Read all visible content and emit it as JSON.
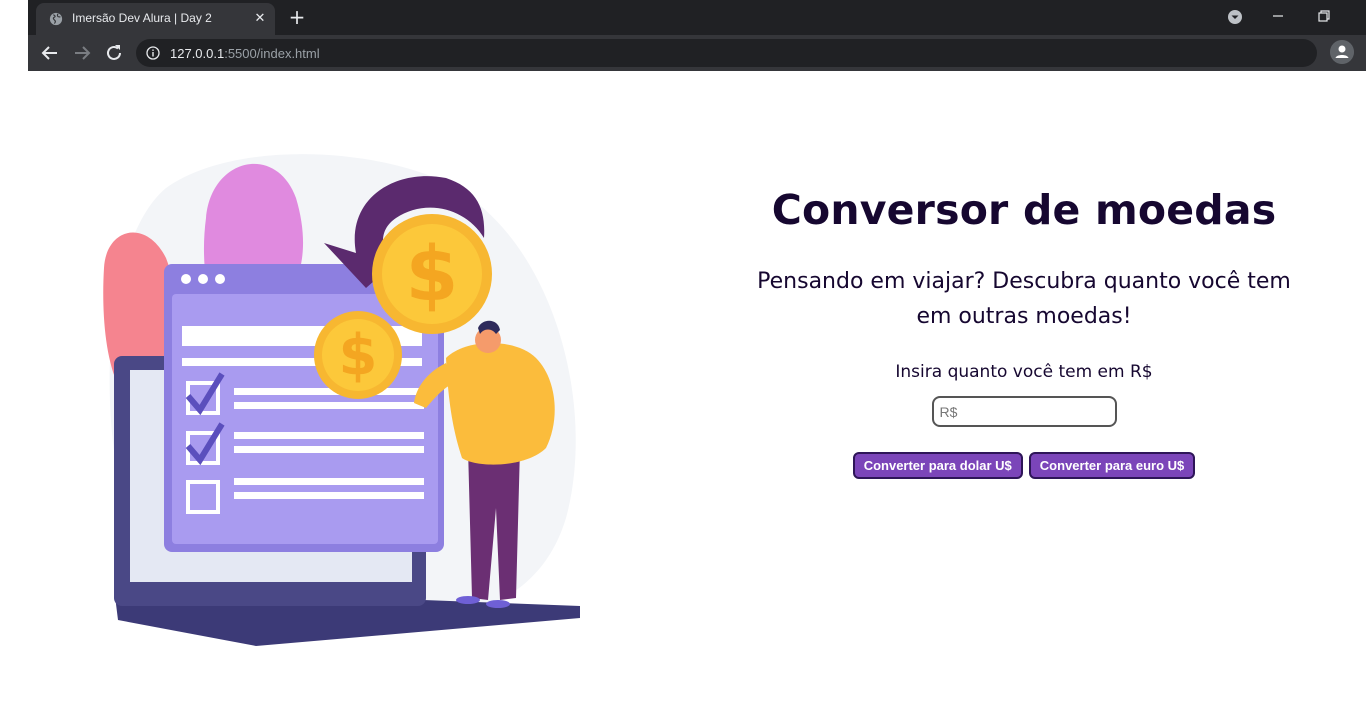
{
  "browser": {
    "tab_title": "Imersão Dev Alura | Day 2",
    "url_host": "127.0.0.1",
    "url_rest": ":5500/index.html"
  },
  "page": {
    "title": "Conversor de moedas",
    "subtitle": "Pensando em viajar? Descubra quanto você tem em outras moedas!",
    "input_label": "Insira quanto você tem em R$",
    "input_placeholder": "R$",
    "input_value": "",
    "btn_dollar": "Converter para dolar U$",
    "btn_euro": "Converter para euro U$"
  },
  "colors": {
    "title_text": "#160730",
    "button_bg": "#7b45b9",
    "button_border": "#2e1558",
    "chrome_dark": "#202124",
    "chrome_toolbar": "#35363a"
  },
  "icons": [
    "globe-icon",
    "close-icon",
    "plus-icon",
    "tab-search-icon",
    "minimize-icon",
    "restore-icon",
    "back-arrow-icon",
    "forward-arrow-icon",
    "reload-icon",
    "info-icon",
    "star-icon",
    "profile-icon"
  ]
}
